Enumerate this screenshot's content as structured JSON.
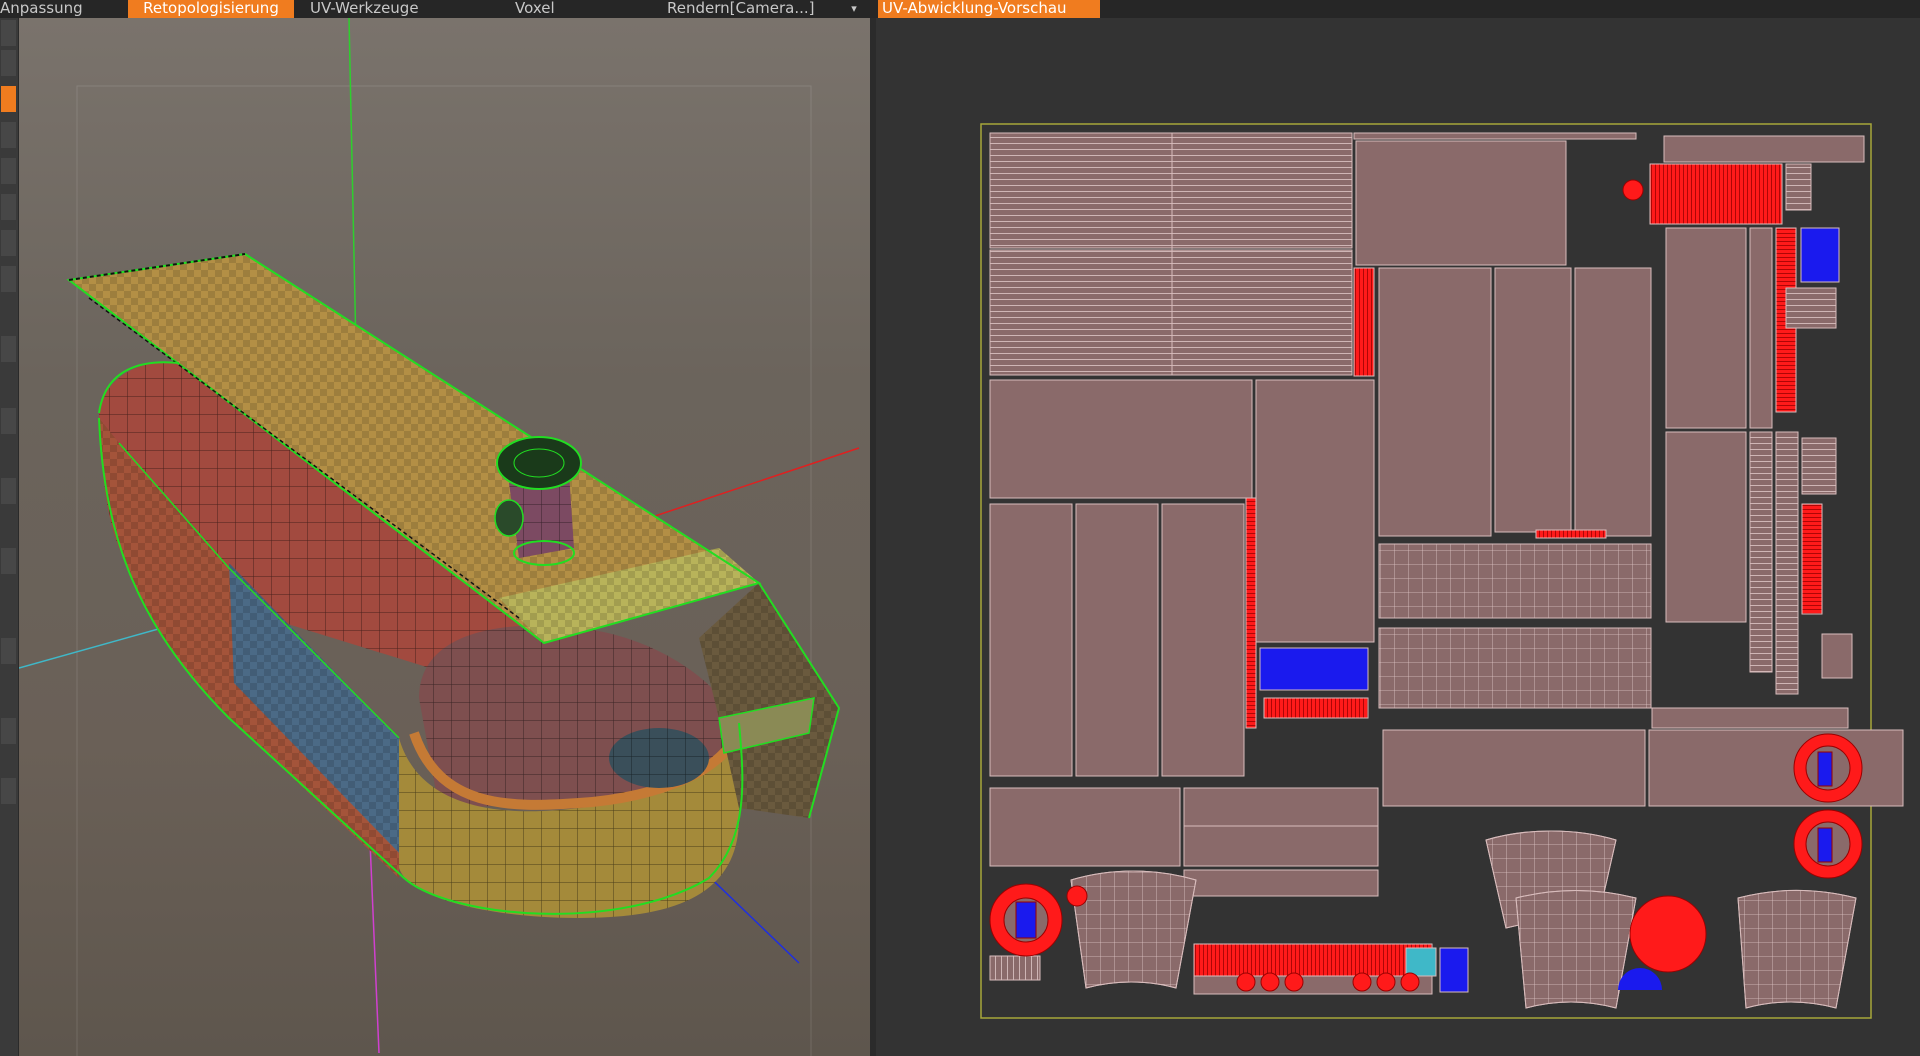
{
  "menu": {
    "tabs": [
      {
        "label": "Anpassung"
      },
      {
        "label": "Retopologisierung",
        "active": true
      },
      {
        "label": "UV-Werkzeuge"
      },
      {
        "label": "Voxel"
      }
    ],
    "render_dropdown": "Rendern[Camera...]",
    "uv_preview_tab": "UV-Abwicklung-Vorschau",
    "accent_color": "#f07c1f"
  },
  "icons": {
    "dropdown": "chevron-down-icon"
  },
  "viewport": {
    "axis_colors": {
      "x": "#e02020",
      "y": "#2ecf2e",
      "z": "#1f2fe0",
      "extra": "#3fb8c8",
      "extra2": "#d040d0"
    },
    "wireframe_color": "#22dd22"
  },
  "uv_preview": {
    "uv_color": "#8a6a6a",
    "highlight_color": "#ff1a1a",
    "flipped_color": "#1a1aee",
    "frame_color": "#a7a83a"
  }
}
